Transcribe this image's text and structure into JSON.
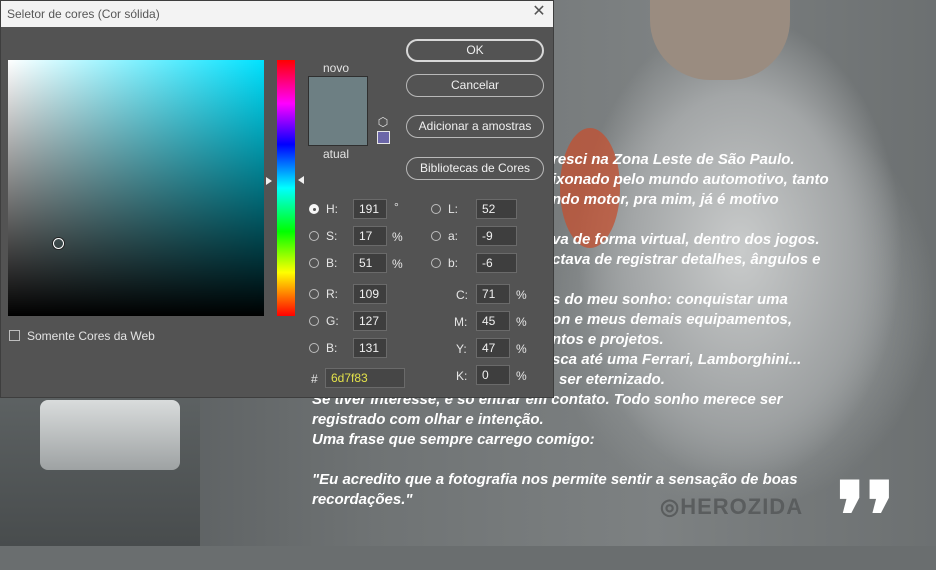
{
  "dialog": {
    "title": "Seletor de cores (Cor sólida)",
    "close_glyph": "✕",
    "swatch_new_label": "novo",
    "swatch_current_label": "atual",
    "new_color": "#6d7f83",
    "current_color": "#6d7f83",
    "buttons": {
      "ok": "OK",
      "cancel": "Cancelar",
      "add_to_swatches": "Adicionar a amostras",
      "color_libraries": "Bibliotecas de Cores"
    },
    "fields": {
      "H": {
        "label": "H:",
        "value": "191",
        "unit": "°"
      },
      "S": {
        "label": "S:",
        "value": "17",
        "unit": "%"
      },
      "B": {
        "label": "B:",
        "value": "51",
        "unit": "%"
      },
      "R": {
        "label": "R:",
        "value": "109"
      },
      "G": {
        "label": "G:",
        "value": "127"
      },
      "Bl": {
        "label": "B:",
        "value": "131"
      },
      "L": {
        "label": "L:",
        "value": "52"
      },
      "a": {
        "label": "a:",
        "value": "-9"
      },
      "b": {
        "label": "b:",
        "value": "-6"
      },
      "C": {
        "label": "C:",
        "value": "71",
        "unit": "%"
      },
      "M": {
        "label": "M:",
        "value": "45",
        "unit": "%"
      },
      "Y": {
        "label": "Y:",
        "value": "47",
        "unit": "%"
      },
      "K": {
        "label": "K:",
        "value": "0",
        "unit": "%"
      }
    },
    "hex_label": "#",
    "hex_value": "6d7f83",
    "web_colors_only_label": "Somente Cores da Web",
    "web_colors_only_checked": false,
    "selected_mode": "H"
  },
  "background": {
    "story_lines": [
      "resci na Zona Leste de São Paulo.",
      "ixonado pelo mundo automotivo, tanto",
      "ndo motor, pra mim, já é motivo",
      "",
      "va de forma virtual, dentro dos jogos.",
      "ctava de registrar detalhes, ângulos e",
      "",
      "s do meu sonho: conquistar uma",
      "on e meus demais equipamentos,",
      "ntos e projetos.",
      "sca até uma Ferrari, Lamborghini...",
      "ser eternizado.",
      "Se tiver interesse, é só entrar em contato. Todo sonho merece ser",
      "registrado com olhar e intenção.",
      "Uma frase que sempre carrego comigo:",
      "",
      "\"Eu acredito que a fotografia nos permite sentir a sensação de boas",
      "recordações.\""
    ],
    "watermark_text": "◎HEROZIDA",
    "quote_mark": "❜❜"
  }
}
